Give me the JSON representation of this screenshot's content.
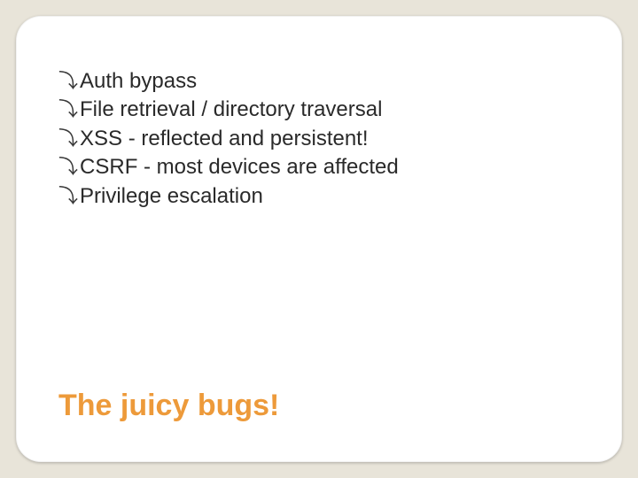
{
  "slide": {
    "bullets": [
      "Auth bypass",
      "File retrieval / directory traversal",
      "XSS - reflected and persistent!",
      "CSRF - most devices are affected",
      "Privilege escalation"
    ],
    "bullet_glyph": "⤵",
    "title": "The juicy bugs!"
  }
}
